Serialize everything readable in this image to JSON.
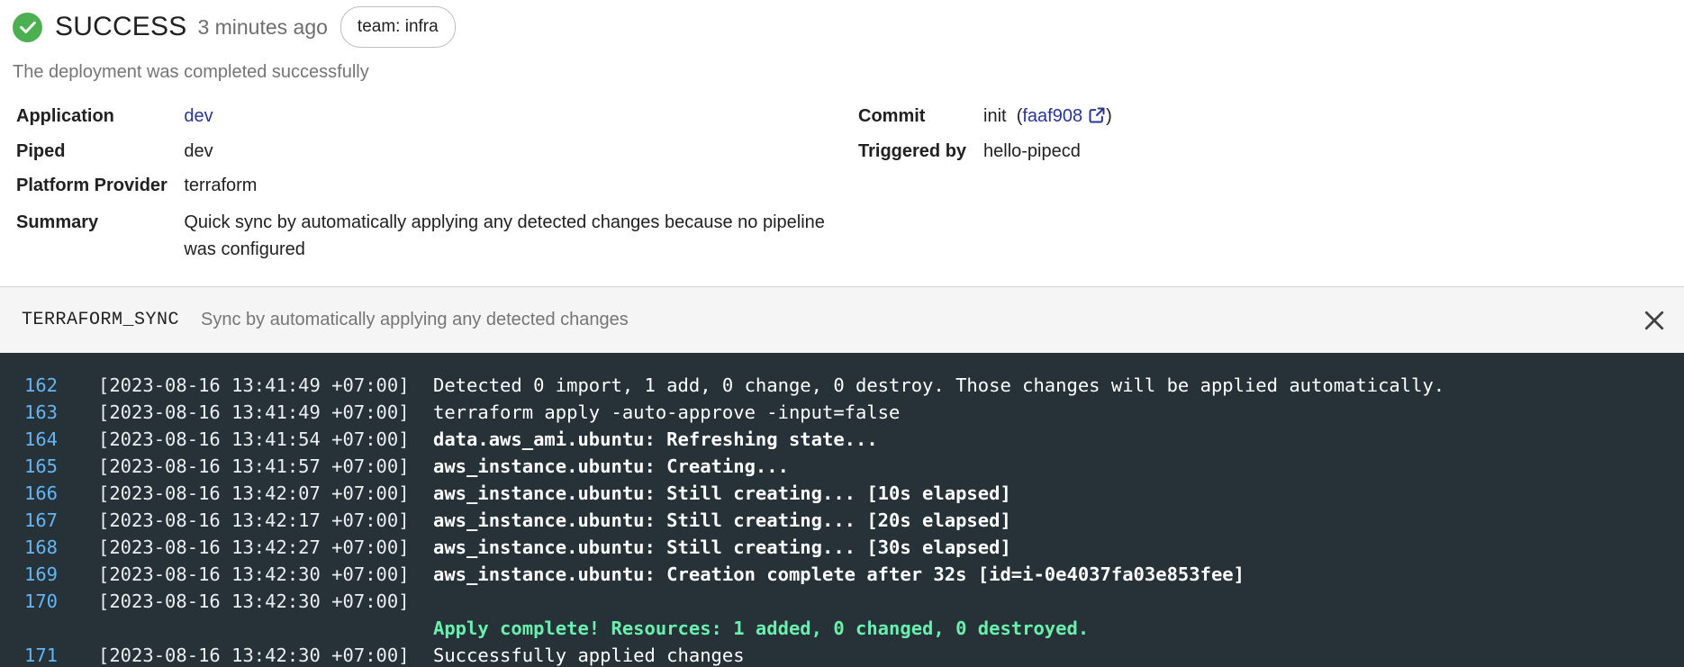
{
  "header": {
    "status": "SUCCESS",
    "time_ago": "3 minutes ago",
    "label_chip": "team: infra",
    "status_color": "#4caf50"
  },
  "description": "The deployment was completed successfully",
  "info": {
    "application": {
      "key": "Application",
      "value": "dev"
    },
    "piped": {
      "key": "Piped",
      "value": "dev"
    },
    "platform_provider": {
      "key": "Platform Provider",
      "value": "terraform"
    },
    "summary": {
      "key": "Summary",
      "value": "Quick sync by automatically applying any detected changes because no pipeline was configured"
    },
    "commit": {
      "key": "Commit",
      "message": "init",
      "hash": "faaf908",
      "open_paren": "(",
      "close_paren": ")"
    },
    "triggered_by": {
      "key": "Triggered by",
      "value": "hello-pipecd"
    }
  },
  "stage": {
    "name": "TERRAFORM_SYNC",
    "description": "Sync by automatically applying any detected changes"
  },
  "log": {
    "colors": {
      "background": "#263238",
      "line_number": "#64b5f6",
      "success": "#69f0ae"
    },
    "lines": [
      {
        "num": "162",
        "ts": "[2023-08-16 13:41:49 +07:00]",
        "msg": "Detected 0 import, 1 add, 0 change, 0 destroy. Those changes will be applied automatically.",
        "style": "normal"
      },
      {
        "num": "163",
        "ts": "[2023-08-16 13:41:49 +07:00]",
        "msg": "terraform apply -auto-approve -input=false",
        "style": "normal"
      },
      {
        "num": "164",
        "ts": "[2023-08-16 13:41:54 +07:00]",
        "msg": "data.aws_ami.ubuntu: Refreshing state...",
        "style": "bold"
      },
      {
        "num": "165",
        "ts": "[2023-08-16 13:41:57 +07:00]",
        "msg": "aws_instance.ubuntu: Creating...",
        "style": "bold"
      },
      {
        "num": "166",
        "ts": "[2023-08-16 13:42:07 +07:00]",
        "msg": "aws_instance.ubuntu: Still creating... [10s elapsed]",
        "style": "bold"
      },
      {
        "num": "167",
        "ts": "[2023-08-16 13:42:17 +07:00]",
        "msg": "aws_instance.ubuntu: Still creating... [20s elapsed]",
        "style": "bold"
      },
      {
        "num": "168",
        "ts": "[2023-08-16 13:42:27 +07:00]",
        "msg": "aws_instance.ubuntu: Still creating... [30s elapsed]",
        "style": "bold"
      },
      {
        "num": "169",
        "ts": "[2023-08-16 13:42:30 +07:00]",
        "msg": "aws_instance.ubuntu: Creation complete after 32s [id=i-0e4037fa03e853fee]",
        "style": "bold"
      },
      {
        "num": "170",
        "ts": "[2023-08-16 13:42:30 +07:00]",
        "msg": "",
        "style": "normal"
      },
      {
        "num": "",
        "ts": "",
        "msg": "Apply complete! Resources: 1 added, 0 changed, 0 destroyed.",
        "style": "green"
      },
      {
        "num": "171",
        "ts": "[2023-08-16 13:42:30 +07:00]",
        "msg": "Successfully applied changes",
        "style": "normal"
      }
    ]
  }
}
